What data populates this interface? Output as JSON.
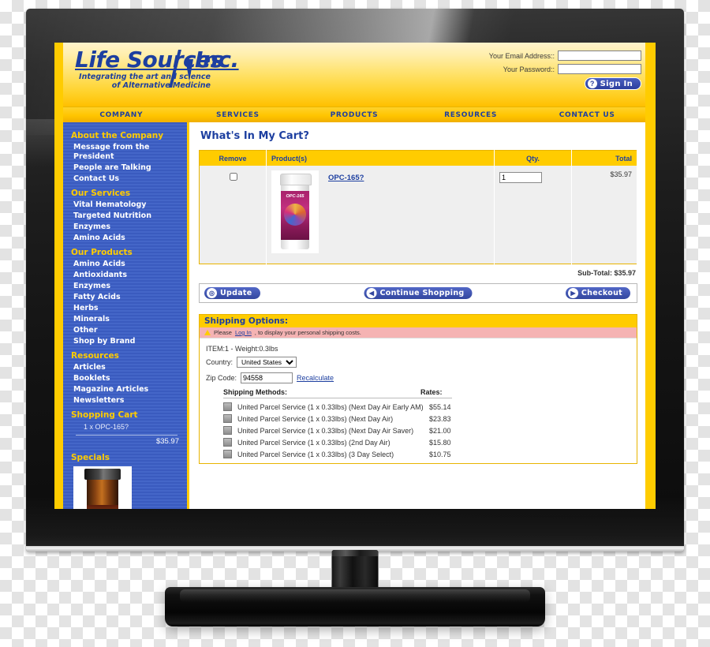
{
  "site": {
    "logo_main": "Life Sources",
    "logo_main2": "Inc.",
    "logo_tagline_1": "Integrating the art and science",
    "logo_tagline_2": "of Alternative Medicine"
  },
  "login": {
    "email_label": "Your Email Address::",
    "email_value": "",
    "password_label": "Your Password::",
    "password_value": "",
    "signin_label": "Sign In",
    "signin_icon": "key-icon"
  },
  "nav": {
    "items": [
      {
        "label": "COMPANY"
      },
      {
        "label": "SERVICES"
      },
      {
        "label": "PRODUCTS"
      },
      {
        "label": "RESOURCES"
      },
      {
        "label": "CONTACT US"
      }
    ]
  },
  "sidebar": {
    "sections": [
      {
        "heading": "About the Company",
        "links": [
          "Message from the President",
          "People are Talking",
          "Contact Us"
        ]
      },
      {
        "heading": "Our Services",
        "links": [
          "Vital Hematology",
          "Targeted Nutrition",
          "Enzymes",
          "Amino Acids"
        ]
      },
      {
        "heading": "Our Products",
        "links": [
          "Amino Acids",
          "Antioxidants",
          "Enzymes",
          "Fatty Acids",
          "Herbs",
          "Minerals",
          "Other",
          "Shop by Brand"
        ]
      },
      {
        "heading": "Resources",
        "links": [
          "Articles",
          "Booklets",
          "Magazine Articles",
          "Newsletters"
        ]
      }
    ],
    "cart": {
      "heading": "Shopping Cart",
      "item": "1 x OPC-165?",
      "total": "$35.97"
    },
    "specials": {
      "heading": "Specials"
    }
  },
  "main": {
    "title": "What's In My Cart?",
    "cart_table": {
      "headers": [
        "Remove",
        "Product(s)",
        "Qty.",
        "Total"
      ],
      "rows": [
        {
          "remove_checked": false,
          "product_name": "OPC-165?",
          "product_image_label": "OPC-165",
          "qty": "1",
          "total": "$35.97"
        }
      ]
    },
    "subtotal": "Sub-Total: $35.97",
    "actions": [
      {
        "label": "Update",
        "icon": "refresh-icon",
        "glyph": "◎"
      },
      {
        "label": "Continue Shopping",
        "icon": "arrow-left-icon",
        "glyph": "◀"
      },
      {
        "label": "Checkout",
        "icon": "arrow-right-icon",
        "glyph": "▶"
      }
    ]
  },
  "shipping": {
    "heading": "Shipping Options:",
    "alert_prefix": "Please ",
    "alert_link": "Log In",
    "alert_suffix": ", to display your personal shipping costs.",
    "alert_icon": "warning-icon",
    "item_weight": "ITEM:1 - Weight:0.3lbs",
    "country_label": "Country:",
    "country_value": "United States",
    "country_options": [
      "United States"
    ],
    "zip_label": "Zip Code:",
    "zip_value": "94558",
    "recalculate_label": "Recalculate",
    "methods_header": "Shipping Methods:",
    "rates_header": "Rates:",
    "methods": [
      {
        "name": "United Parcel Service (1 x 0.33lbs) (Next Day Air Early AM)",
        "rate": "$55.14"
      },
      {
        "name": "United Parcel Service (1 x 0.33lbs) (Next Day Air)",
        "rate": "$23.83"
      },
      {
        "name": "United Parcel Service (1 x 0.33lbs) (Next Day Air Saver)",
        "rate": "$21.00"
      },
      {
        "name": "United Parcel Service (1 x 0.33lbs) (2nd Day Air)",
        "rate": "$15.80"
      },
      {
        "name": "United Parcel Service (1 x 0.33lbs) (3 Day Select)",
        "rate": "$10.75"
      }
    ]
  },
  "colors": {
    "brand_yellow": "#FFCC00",
    "brand_blue": "#1D3FA0",
    "sidebar_blue": "#3A5BBF",
    "alert_pink": "#F5B3B3"
  }
}
